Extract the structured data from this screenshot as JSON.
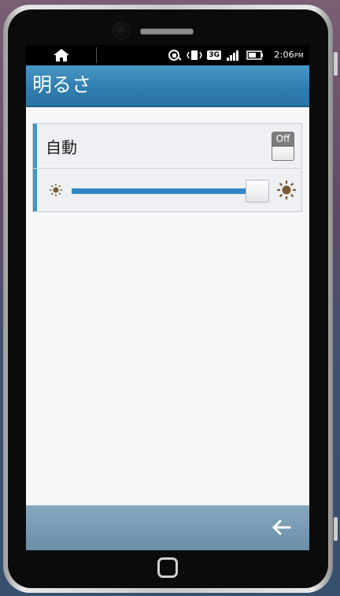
{
  "statusbar": {
    "time": "2:06",
    "ampm": "PM",
    "network": "3G",
    "icons": [
      "home-icon",
      "sync-icon",
      "vibrate-icon",
      "3g-icon",
      "signal-icon",
      "battery-icon"
    ]
  },
  "app": {
    "title": "明るさ"
  },
  "settings": {
    "auto_label": "自動",
    "auto_toggle_state": "Off",
    "brightness_level": 1.0,
    "min_icon": "sun-small-icon",
    "max_icon": "sun-large-icon"
  },
  "navigation": {
    "back_icon": "back-arrow-icon"
  },
  "colors": {
    "titlebar": "#2f7eb0",
    "accent": "#3f95c8",
    "slider_fill": "#2f86c2",
    "sun": "#7a5a2e"
  }
}
